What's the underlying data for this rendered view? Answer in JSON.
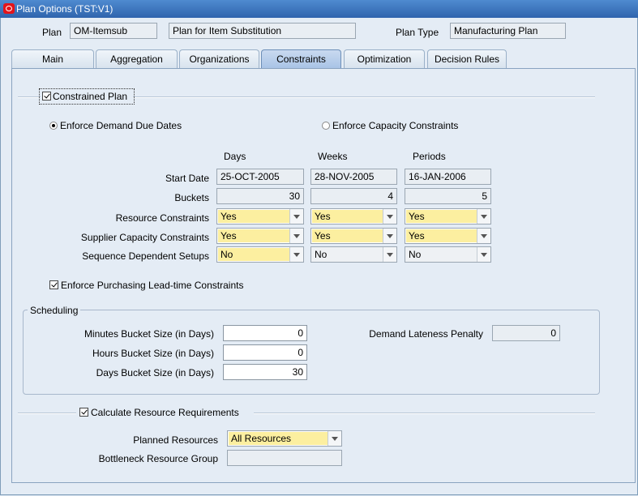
{
  "window": {
    "title": "Plan Options (TST:V1)"
  },
  "header": {
    "plan_label": "Plan",
    "plan_code": "OM-Itemsub",
    "plan_description": "Plan for Item Substitution",
    "plan_type_label": "Plan Type",
    "plan_type_value": "Manufacturing Plan"
  },
  "tabs": [
    {
      "label": "Main"
    },
    {
      "label": "Aggregation"
    },
    {
      "label": "Organizations"
    },
    {
      "label": "Constraints",
      "active": true
    },
    {
      "label": "Optimization"
    },
    {
      "label": "Decision Rules"
    }
  ],
  "constraints": {
    "constrained_plan_label": "Constrained Plan",
    "constrained_plan_checked": true,
    "enforce_demand_due_dates_label": "Enforce Demand Due Dates",
    "enforce_capacity_constraints_label": "Enforce Capacity Constraints",
    "selected_option": "enforce_demand_due_dates",
    "columns": [
      "Days",
      "Weeks",
      "Periods"
    ],
    "rows": {
      "start_date": {
        "label": "Start Date",
        "values": [
          "25-OCT-2005",
          "28-NOV-2005",
          "16-JAN-2006"
        ]
      },
      "buckets": {
        "label": "Buckets",
        "values": [
          "30",
          "4",
          "5"
        ]
      },
      "resource_constraints": {
        "label": "Resource Constraints",
        "values": [
          "Yes",
          "Yes",
          "Yes"
        ]
      },
      "supplier_capacity_constraints": {
        "label": "Supplier Capacity Constraints",
        "values": [
          "Yes",
          "Yes",
          "Yes"
        ]
      },
      "sequence_dependent_setups": {
        "label": "Sequence Dependent Setups",
        "values": [
          "No",
          "No",
          "No"
        ]
      }
    },
    "enforce_purchasing_leadtime_label": "Enforce Purchasing Lead-time Constraints",
    "enforce_purchasing_leadtime_checked": true
  },
  "scheduling": {
    "group_label": "Scheduling",
    "minutes_bucket_label": "Minutes Bucket Size (in Days)",
    "minutes_bucket_value": "0",
    "hours_bucket_label": "Hours Bucket Size (in Days)",
    "hours_bucket_value": "0",
    "days_bucket_label": "Days Bucket Size (in Days)",
    "days_bucket_value": "30",
    "demand_lateness_label": "Demand Lateness Penalty",
    "demand_lateness_value": "0"
  },
  "resources": {
    "calculate_label": "Calculate Resource Requirements",
    "calculate_checked": true,
    "planned_resources_label": "Planned Resources",
    "planned_resources_value": "All Resources",
    "bottleneck_label": "Bottleneck Resource Group",
    "bottleneck_value": ""
  },
  "colors": {
    "title_bar": "#2f64ad",
    "active_tab": "#a9c4e6",
    "required_field": "#fcefa0",
    "background": "#e4ecf5"
  }
}
